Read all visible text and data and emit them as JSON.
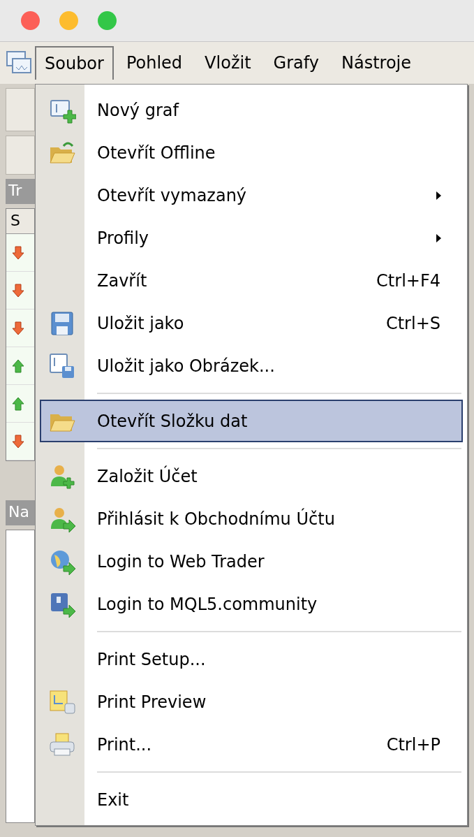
{
  "menubar": {
    "items": [
      {
        "label": "Soubor",
        "selected": true
      },
      {
        "label": "Pohled",
        "selected": false
      },
      {
        "label": "Vložit",
        "selected": false
      },
      {
        "label": "Grafy",
        "selected": false
      },
      {
        "label": "Nástroje",
        "selected": false
      }
    ]
  },
  "background": {
    "panel_title": "Tr",
    "column_header": "S",
    "trade_rows": [
      {
        "kind": "down"
      },
      {
        "kind": "down"
      },
      {
        "kind": "down"
      },
      {
        "kind": "up"
      },
      {
        "kind": "up"
      },
      {
        "kind": "down"
      }
    ],
    "navigator_title": "Na"
  },
  "menu": [
    {
      "kind": "item",
      "label": "Nový graf",
      "selected": false,
      "submenu": false
    },
    {
      "kind": "item",
      "label": "Otevřít Offline",
      "selected": false,
      "submenu": false
    },
    {
      "kind": "item",
      "label": "Otevřít vymazaný",
      "selected": false,
      "submenu": true
    },
    {
      "kind": "item",
      "label": "Profily",
      "selected": false,
      "submenu": true
    },
    {
      "kind": "item",
      "label": "Zavřít",
      "shortcut": "Ctrl+F4",
      "selected": false,
      "submenu": false
    },
    {
      "kind": "item",
      "label": "Uložit jako",
      "shortcut": "Ctrl+S",
      "selected": false,
      "submenu": false
    },
    {
      "kind": "item",
      "label": "Uložit jako Obrázek...",
      "selected": false,
      "submenu": false
    },
    {
      "kind": "separator"
    },
    {
      "kind": "item",
      "label": "Otevřít Složku dat",
      "selected": true,
      "submenu": false
    },
    {
      "kind": "separator"
    },
    {
      "kind": "item",
      "label": "Založit Účet",
      "selected": false,
      "submenu": false
    },
    {
      "kind": "item",
      "label": "Přihlásit k Obchodnímu Účtu",
      "selected": false,
      "submenu": false
    },
    {
      "kind": "item",
      "label": "Login to Web Trader",
      "selected": false,
      "submenu": false
    },
    {
      "kind": "item",
      "label": "Login to MQL5.community",
      "selected": false,
      "submenu": false
    },
    {
      "kind": "separator"
    },
    {
      "kind": "item",
      "label": "Print Setup...",
      "selected": false,
      "submenu": false
    },
    {
      "kind": "item",
      "label": "Print Preview",
      "selected": false,
      "submenu": false
    },
    {
      "kind": "item",
      "label": "Print...",
      "shortcut": "Ctrl+P",
      "selected": false,
      "submenu": false
    },
    {
      "kind": "separator"
    },
    {
      "kind": "item",
      "label": "Exit",
      "selected": false,
      "submenu": false
    }
  ]
}
